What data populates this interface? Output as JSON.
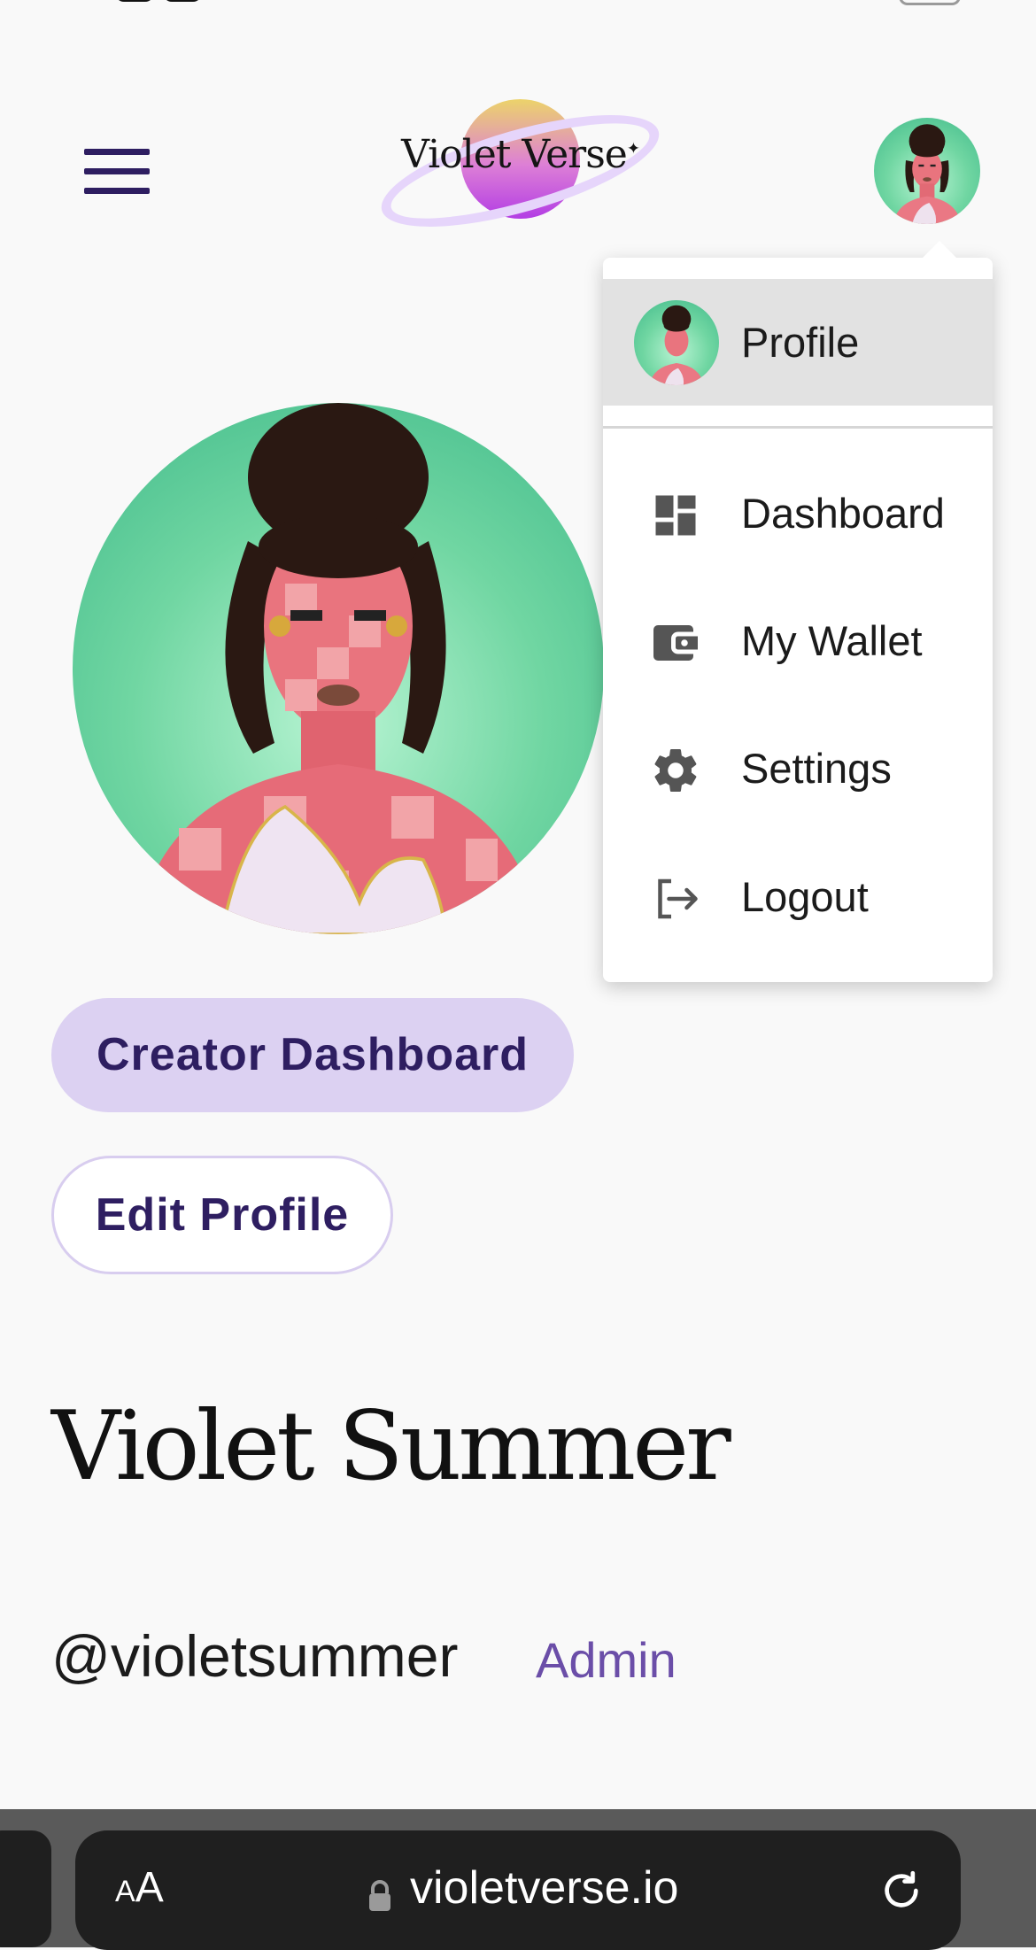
{
  "header": {
    "logo_text": "Violet Verse",
    "logo_mark": "✦"
  },
  "menu": {
    "profile_label": "Profile",
    "items": [
      {
        "label": "Dashboard",
        "icon": "dashboard-icon"
      },
      {
        "label": "My Wallet",
        "icon": "wallet-icon"
      },
      {
        "label": "Settings",
        "icon": "gear-icon"
      },
      {
        "label": "Logout",
        "icon": "logout-icon"
      }
    ]
  },
  "profile": {
    "creator_dashboard_label": "Creator Dashboard",
    "edit_profile_label": "Edit Profile",
    "display_name": "Violet Summer",
    "handle": "@violetsummer",
    "role": "Admin"
  },
  "browser": {
    "text_size_label_small": "A",
    "text_size_label_large": "A",
    "url": "violetverse.io"
  },
  "colors": {
    "brand_dark": "#2e1e61",
    "pill_bg": "#dcd1f2",
    "role_text": "#6b4ea8",
    "page_bg": "#f9f9f9"
  }
}
